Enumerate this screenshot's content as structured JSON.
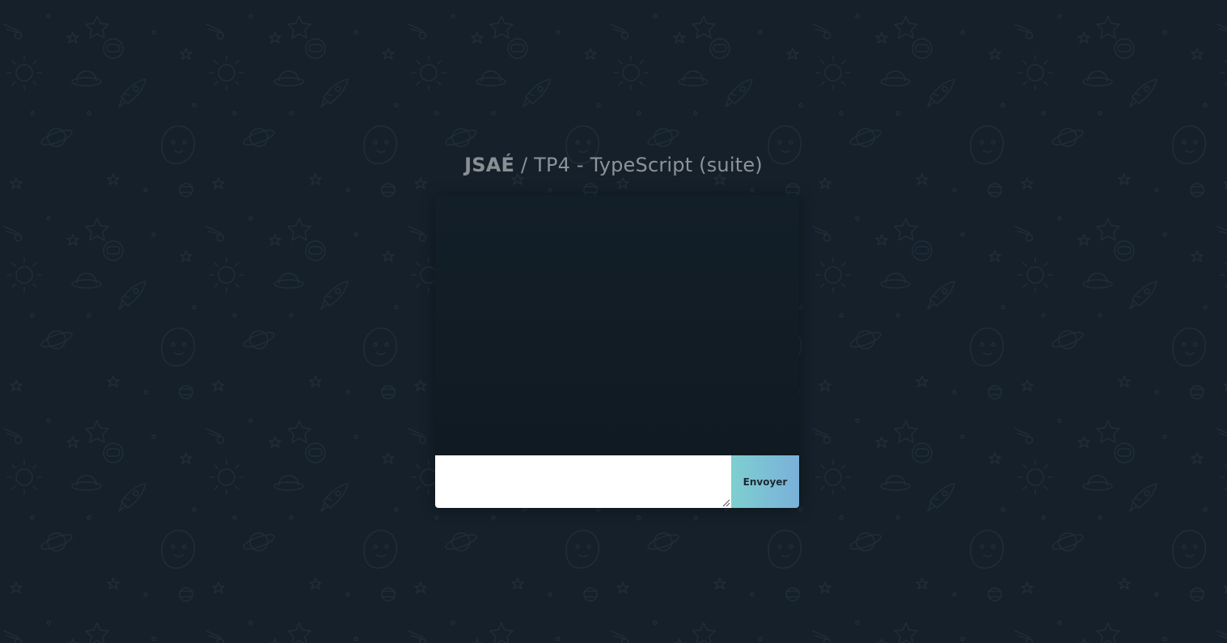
{
  "header": {
    "brand": "JSAÉ",
    "separator": " / ",
    "subtitle": "TP4 - TypeScript (suite)"
  },
  "chat": {
    "messages": [],
    "input": {
      "value": "",
      "placeholder": ""
    },
    "send_label": "Envoyer"
  },
  "colors": {
    "background": "#15202a",
    "panel": "#121d26",
    "send_gradient_start": "#7ecfd0",
    "send_gradient_end": "#7ab0d9",
    "title_text": "#8c9399"
  },
  "icons": {
    "background_pattern": "doodle-pattern",
    "textarea_resize": "resize-grip-icon"
  }
}
